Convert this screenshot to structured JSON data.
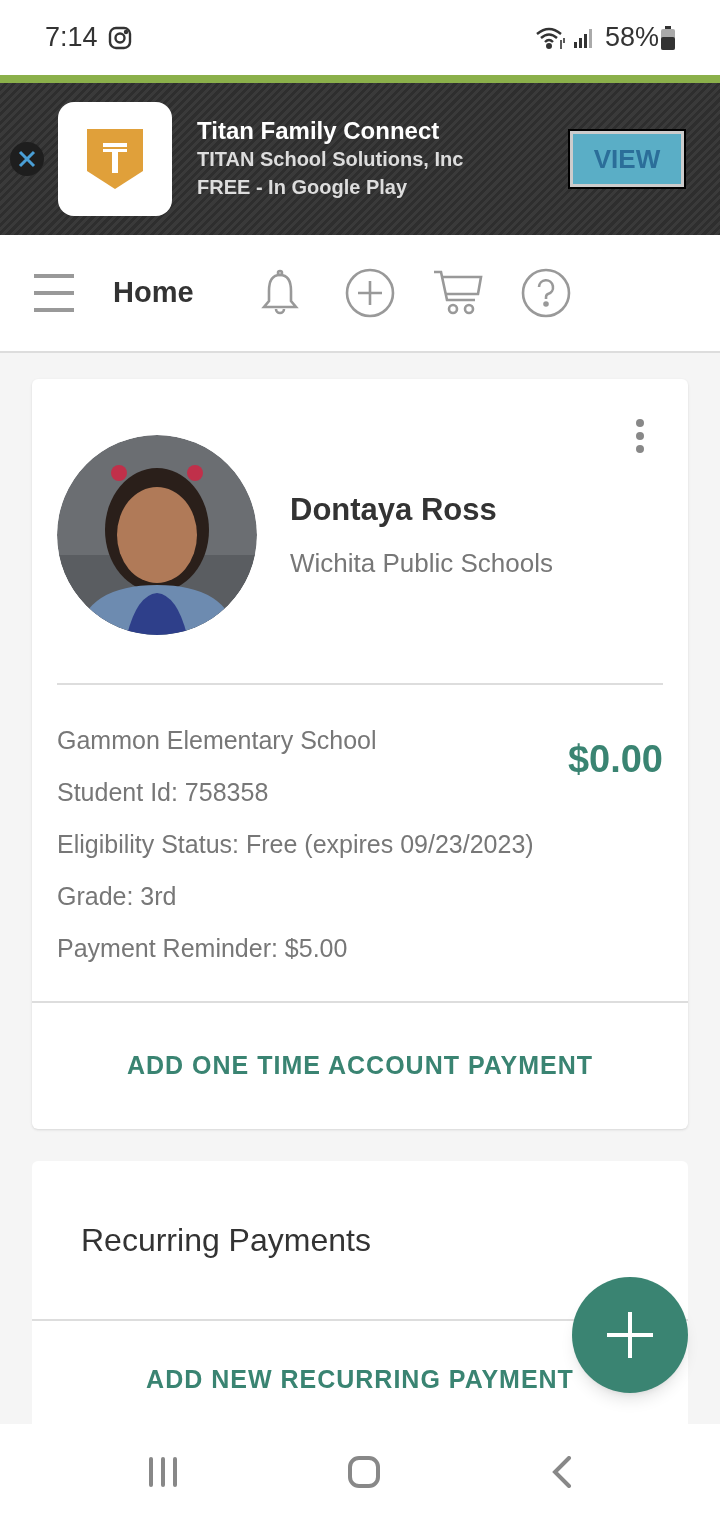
{
  "status_bar": {
    "time": "7:14",
    "battery": "58%"
  },
  "ad_banner": {
    "title": "Titan Family Connect",
    "publisher": "TITAN School Solutions, Inc",
    "price": "FREE - In Google Play",
    "button": "VIEW"
  },
  "header": {
    "title": "Home"
  },
  "student_card": {
    "name": "Dontaya Ross",
    "district": "Wichita Public Schools",
    "balance": "$0.00",
    "details": [
      "Gammon Elementary School",
      "Student Id: 758358",
      "Eligibility Status: Free (expires 09/23/2023)",
      "Grade: 3rd",
      "Payment Reminder: $5.00"
    ],
    "action": "ADD ONE TIME ACCOUNT PAYMENT"
  },
  "recurring_card": {
    "title": "Recurring Payments",
    "action": "ADD NEW RECURRING PAYMENT"
  }
}
